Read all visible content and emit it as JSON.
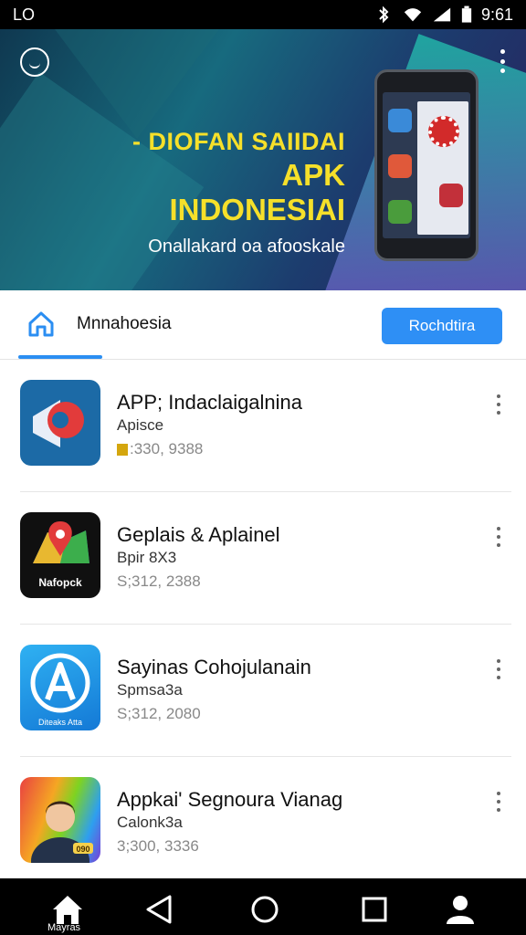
{
  "status_bar": {
    "carrier": "LO",
    "time": "9:61"
  },
  "banner": {
    "headline_1": "- DIOFAN SAIIDAI",
    "headline_2": "APK INDONESIAI",
    "subline": "Onallakard oa afooskale"
  },
  "tab_bar": {
    "label": "Mnnahoesia",
    "action_label": "Rochdtira"
  },
  "apps": [
    {
      "title": "APP; Indaclaigalnina",
      "subtitle": "Apisce",
      "meta": ":330, 9388"
    },
    {
      "title": "Geplais & Aplainel",
      "subtitle": "Bpir 8X3",
      "meta": "S;312, 2388"
    },
    {
      "title": "Sayinas Cohojulanain",
      "subtitle": "Spmsa3a",
      "meta": "S;312, 2080"
    },
    {
      "title": "Appkai' Segnoura Vianag",
      "subtitle": "Calonk3a",
      "meta": "3;300, 3336"
    }
  ],
  "app_icon_text": {
    "icon2": "Nafopck",
    "icon3": "Diteaks Atta",
    "icon4": "090"
  },
  "nav_bar": {
    "home_label": "Mayras"
  },
  "colors": {
    "accent": "#2e8ff5",
    "banner_text": "#f6e02a"
  }
}
